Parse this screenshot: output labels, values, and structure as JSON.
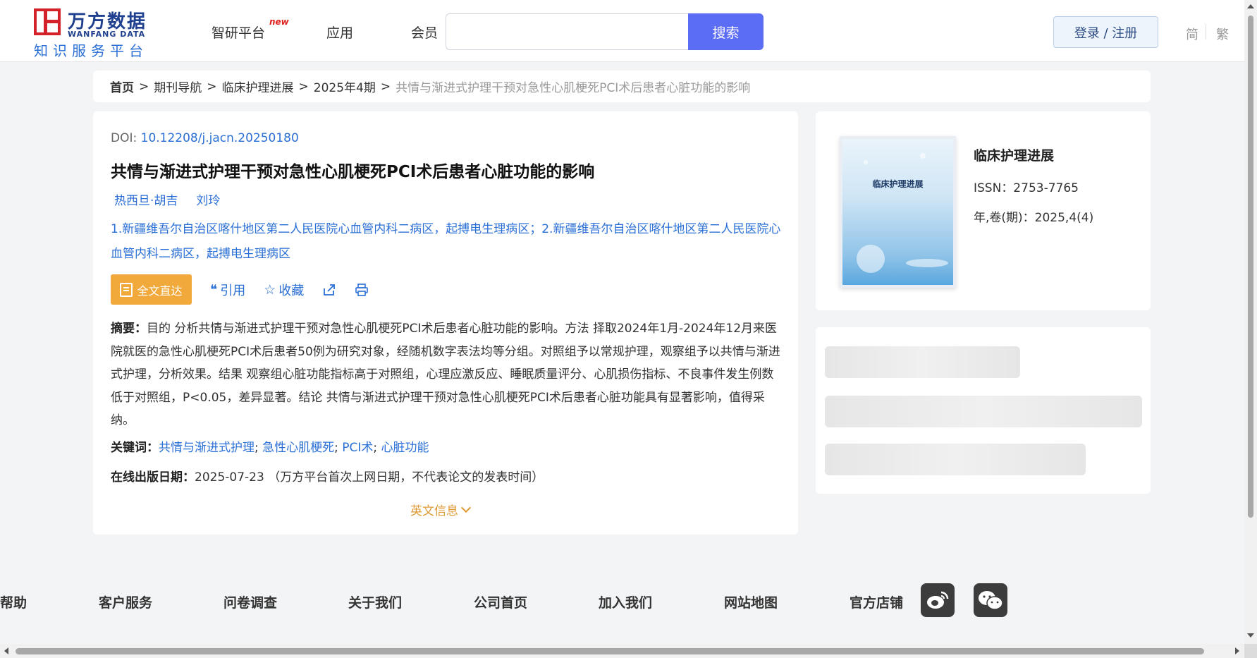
{
  "header": {
    "logo_cn": "万方数据",
    "logo_en": "WANFANG DATA",
    "logo_sub": "知识服务平台",
    "nav": [
      {
        "label": "智研平台",
        "badge": "new"
      },
      {
        "label": "应用"
      },
      {
        "label": "会员"
      }
    ],
    "search_placeholder": "",
    "search_button": "搜索",
    "login_button": "登录 / 注册",
    "lang_simplified": "简",
    "lang_traditional": "繁"
  },
  "breadcrumb": {
    "home": "首页",
    "items": [
      "期刊导航",
      "临床护理进展",
      "2025年4期"
    ],
    "current": "共情与渐进式护理干预对急性心肌梗死PCI术后患者心脏功能的影响",
    "sep": ">"
  },
  "article": {
    "doi_label": "DOI:",
    "doi": "10.12208/j.jacn.20250180",
    "title": "共情与渐进式护理干预对急性心肌梗死PCI术后患者心脏功能的影响",
    "authors": [
      "热西旦·胡吉",
      "刘玲"
    ],
    "affiliation": "1.新疆维吾尔自治区喀什地区第二人民医院心血管内科二病区，起搏电生理病区；2.新疆维吾尔自治区喀什地区第二人民医院心血管内科二病区，起搏电生理病区",
    "actions": {
      "fulltext": "全文直达",
      "cite": "引用",
      "favorite": "收藏"
    },
    "abstract_label": "摘要：",
    "abstract": "目的 分析共情与渐进式护理干预对急性心肌梗死PCI术后患者心脏功能的影响。方法 择取2024年1月-2024年12月来医院就医的急性心肌梗死PCI术后患者50例为研究对象，经随机数字表法均等分组。对照组予以常规护理，观察组予以共情与渐进式护理，分析效果。结果 观察组心脏功能指标高于对照组，心理应激反应、睡眠质量评分、心肌损伤指标、不良事件发生例数低于对照组，P<0.05，差异显著。结论 共情与渐进式护理干预对急性心肌梗死PCI术后患者心脏功能具有显著影响，值得采纳。",
    "keywords_label": "关键词：",
    "keywords": [
      "共情与渐进式护理",
      "急性心肌梗死",
      "PCI术",
      "心脏功能"
    ],
    "pubdate_label": "在线出版日期：",
    "pubdate": "2025-07-23",
    "pubdate_note": "（万方平台首次上网日期，不代表论文的发表时间）",
    "en_info": "英文信息"
  },
  "journal": {
    "cover_title": "临床护理进展",
    "name": "临床护理进展",
    "issn": "ISSN：2753-7765",
    "volume": "年,卷(期)：2025,4(4)"
  },
  "footer": {
    "links": [
      "帮助",
      "客户服务",
      "问卷调查",
      "关于我们",
      "公司首页",
      "加入我们",
      "网站地图",
      "官方店铺"
    ]
  },
  "colors": {
    "brand_blue": "#1f3f8f",
    "brand_red": "#d4222a",
    "link_blue": "#2a6fd6",
    "search_button": "#5b6cf5",
    "fulltext_orange": "#f2a93b"
  }
}
